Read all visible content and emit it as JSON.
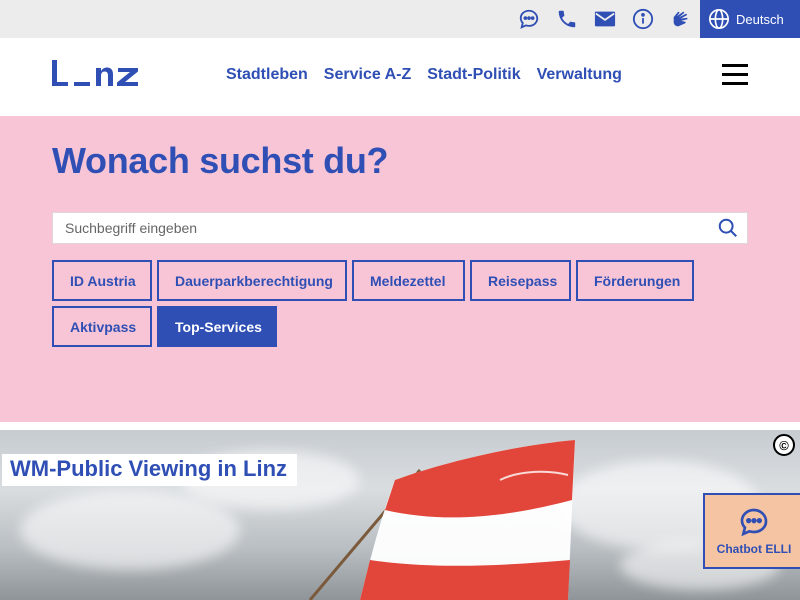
{
  "topbar": {
    "icons": [
      "chat-icon",
      "phone-icon",
      "mail-icon",
      "info-icon",
      "sign-language-icon"
    ],
    "language": "Deutsch"
  },
  "header": {
    "logo": "L_nz",
    "nav": [
      "Stadtleben",
      "Service A-Z",
      "Stadt-Politik",
      "Verwaltung"
    ]
  },
  "hero": {
    "title": "Wonach suchst du?",
    "search_placeholder": "Suchbegriff eingeben",
    "tags": [
      {
        "label": "ID Austria",
        "active": false
      },
      {
        "label": "Dauerparkberechtigung",
        "active": false
      },
      {
        "label": "Meldezettel",
        "active": false
      },
      {
        "label": "Reisepass",
        "active": false
      },
      {
        "label": "Förderungen",
        "active": false
      },
      {
        "label": "Aktivpass",
        "active": false
      },
      {
        "label": "Top-Services",
        "active": true
      }
    ]
  },
  "teaser": {
    "title": "WM-Public Viewing in Linz",
    "copyright": "©"
  },
  "chatbot": {
    "label": "Chatbot ELLI"
  },
  "colors": {
    "brand_blue": "#2f4fb5",
    "hero_pink": "#f7c5d6",
    "chatbot_peach": "#f5c4a2"
  }
}
